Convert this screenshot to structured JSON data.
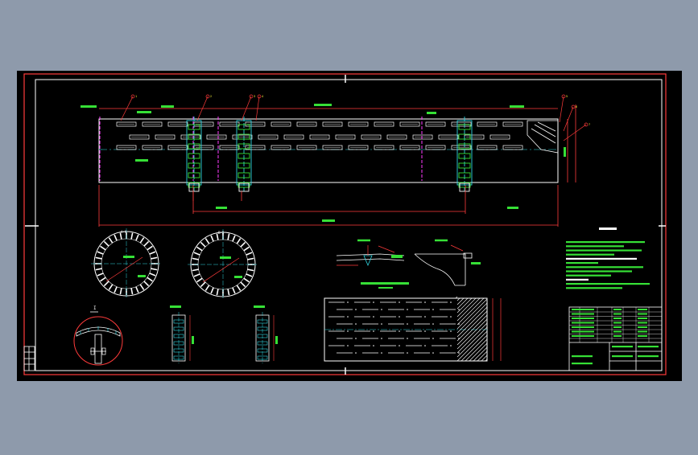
{
  "drawing": {
    "background_color": "#8e9aab",
    "paper_color": "#000000",
    "frame_color": "#ff3b3b",
    "outline_color": "#ffffff",
    "green_color": "#36e036",
    "cyan_color": "#2fd5e0",
    "magenta_color": "#ff3bff",
    "yellow_color": "#ffff3a",
    "section_labels": {
      "circle_a": "A-A",
      "circle_b": "B-B",
      "detail_i": "I",
      "detail_1": "1",
      "detail_2": "2"
    },
    "item_numbers": [
      "1",
      "2",
      "3",
      "4",
      "5",
      "6",
      "7"
    ]
  }
}
